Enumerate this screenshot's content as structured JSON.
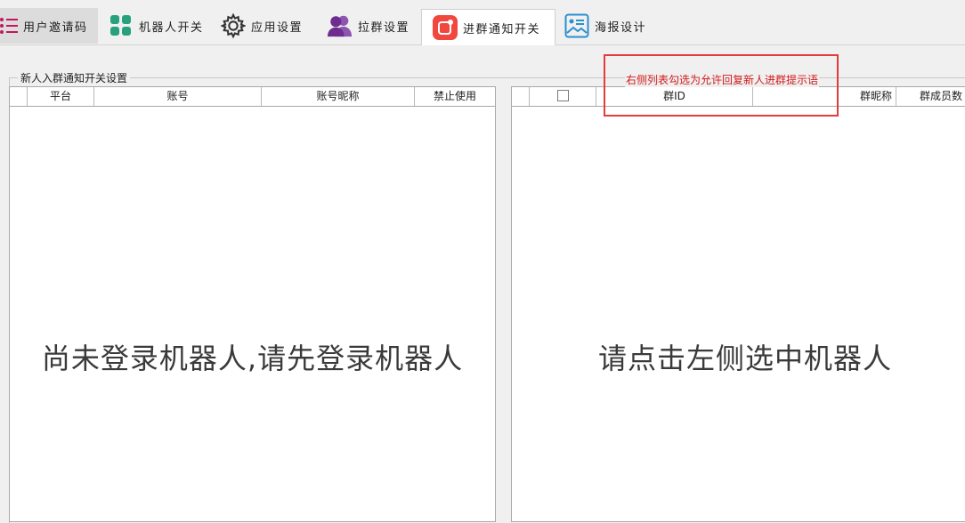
{
  "tabs": [
    {
      "label": "用户邀请码",
      "icon": "list-icon",
      "color": "#c2185b",
      "state": "hovered"
    },
    {
      "label": "机器人开关",
      "icon": "grid-icon",
      "color": "#26a17b",
      "state": "normal"
    },
    {
      "label": "应用设置",
      "icon": "gear-icon",
      "color": "#333333",
      "state": "normal"
    },
    {
      "label": "拉群设置",
      "icon": "group-users-icon",
      "color": "#6d2c8e",
      "state": "normal"
    },
    {
      "label": "进群通知开关",
      "icon": "notify-app-icon",
      "color": "#f2473f",
      "state": "active"
    },
    {
      "label": "海报设计",
      "icon": "poster-icon",
      "color": "#2a8fcf",
      "state": "normal"
    }
  ],
  "group": {
    "title": "新人入群通知开关设置"
  },
  "hint": "右侧列表勾选为允许回复新人进群提示语",
  "left_grid": {
    "columns": [
      "平台",
      "账号",
      "账号昵称",
      "禁止使用"
    ],
    "placeholder": "尚未登录机器人,请先登录机器人"
  },
  "right_grid": {
    "columns": [
      "",
      "群ID",
      "群昵称",
      "群成员数"
    ],
    "placeholder": "请点击左侧选中机器人"
  },
  "colors": {
    "hint_text": "#d21a1a",
    "highlight_box": "#e53b3b"
  }
}
